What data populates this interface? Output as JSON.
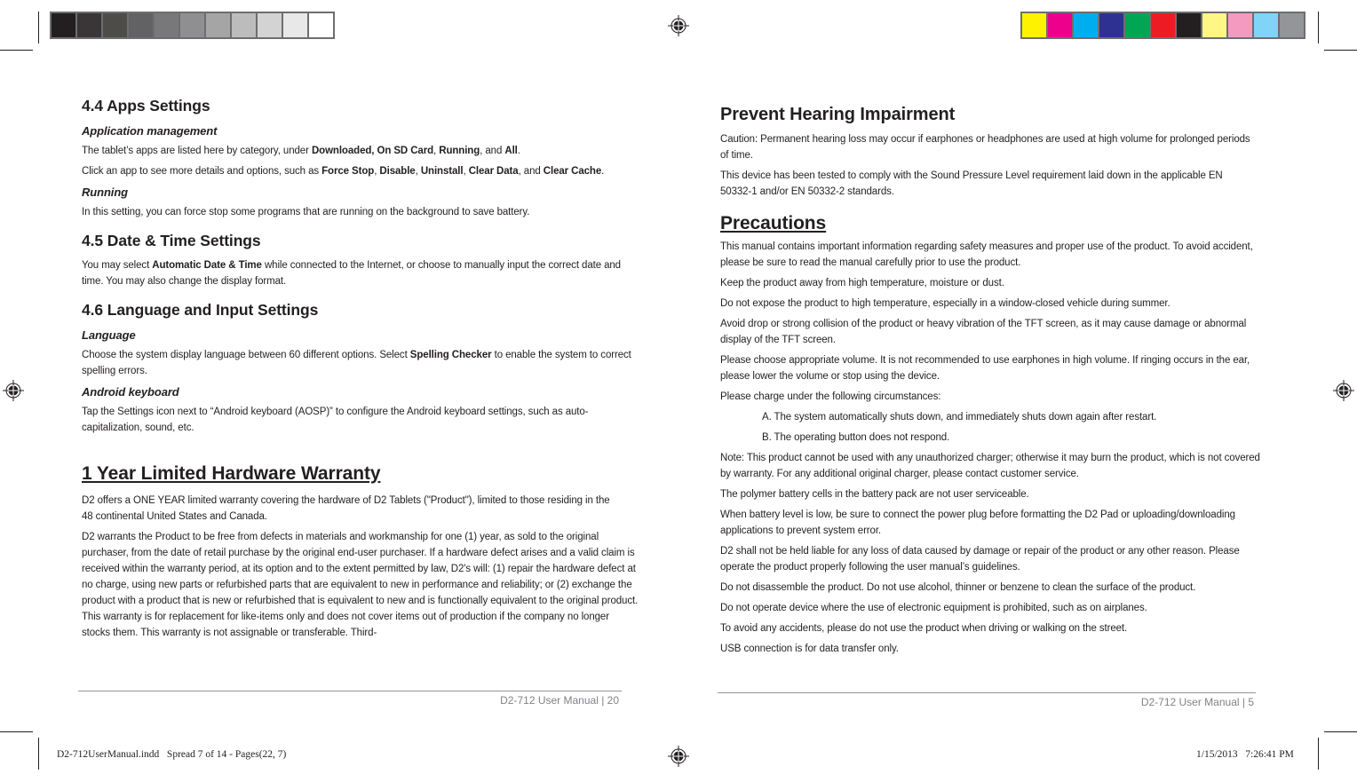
{
  "print_marks": {
    "grayscale_swatches": [
      "#231f20",
      "#3a3637",
      "#4d4c49",
      "#626163",
      "#78777a",
      "#8f8e90",
      "#a6a5a6",
      "#bcbcbd",
      "#d3d3d3",
      "#e8e8e8",
      "#ffffff"
    ],
    "color_swatches": [
      "#fff200",
      "#ec008c",
      "#00aeef",
      "#2e3192",
      "#00a651",
      "#ed1c24",
      "#231f20",
      "#fff685",
      "#f49ac1",
      "#7fd4f8",
      "#939598"
    ]
  },
  "left_page": {
    "section_44": {
      "title": "4.4 Apps Settings",
      "subsection_1": "Application management",
      "p1": {
        "t1": "The tablet’s apps are listed here by category, under ",
        "b1": "Downloaded, On SD Card",
        "t2": ", ",
        "b2": "Running",
        "t3": ", and ",
        "b3": "All",
        "t4": "."
      },
      "p2": {
        "t1": "Click an app to see more details and options, such as ",
        "b1": "Force Stop",
        "t2": ", ",
        "b2": "Disable",
        "t3": ", ",
        "b3": "Uninstall",
        "t4": ", ",
        "b4": "Clear Data",
        "t5": ", and ",
        "b5": "Clear Cache",
        "t6": "."
      },
      "subsection_2": "Running",
      "p3": "In this setting, you can force stop some programs that are running on the background to save battery."
    },
    "section_45": {
      "title": "4.5 Date & Time Settings",
      "p1": {
        "t1": "You may select ",
        "b1": "Automatic Date & Time",
        "t2": " while connected to the Internet, or choose to manually input the correct date and time. You may also change the display format."
      }
    },
    "section_46": {
      "title": "4.6 Language and Input Settings",
      "subsection_1": "Language",
      "p1": {
        "t1": "Choose the system display language between 60 different options. Select ",
        "b1": "Spelling Checker",
        "t2": " to enable the system to correct spelling errors."
      },
      "subsection_2": "Android keyboard",
      "p2": "Tap the Settings icon next to “Android keyboard (AOSP)” to configure the Android keyboard settings, such as auto-capitalization, sound, etc."
    },
    "warranty": {
      "title": "1 Year Limited Hardware Warranty",
      "p1": "D2 offers a ONE YEAR limited warranty covering the hardware of D2 Tablets (\"Product\"), limited to those residing in the 48 continental United States and Canada.",
      "p2": "D2 warrants the Product to be free from defects in materials and workmanship for one (1) year, as sold to the original purchaser, from the date of retail purchase by the original end-user purchaser. If a hardware defect arises and a valid claim is received within the warranty period, at its option and to the extent permitted by law, D2's will: (1) repair the hardware defect at no charge, using new parts or refurbished parts that are equivalent to new in performance and reliability; or (2) exchange the product with a product that is new or refurbished that is equivalent to new and is functionally equivalent to the original product. This warranty is for replacement for like-items only and does not cover items out of production if the company no longer stocks them. This warranty is not assignable or transferable. Third-"
    },
    "footer": "D2-712 User Manual | 20"
  },
  "right_page": {
    "hearing": {
      "title": "Prevent Hearing Impairment",
      "p1": "Caution: Permanent hearing loss may occur if earphones or headphones are used at high volume for prolonged periods of time.",
      "p2": "This device has been tested to comply with the Sound Pressure Level requirement laid down in the applicable EN 50332-1 and/or EN 50332-2 standards."
    },
    "precautions": {
      "title": "Precautions",
      "items": [
        "This manual contains important information regarding safety measures and proper use of the product. To avoid accident, please be sure to read the manual carefully prior to use the product.",
        "Keep the product away from high temperature, moisture or dust.",
        "Do not expose the product to high temperature, especially in a window-closed vehicle during summer.",
        "Avoid drop or strong collision of the product or heavy vibration of the TFT screen, as it may cause damage or abnormal display of the TFT screen.",
        "Please choose appropriate volume. It is not recommended to use earphones in high volume. If ringing occurs in the ear, please lower the volume or stop using the device.",
        "Please charge under the following circumstances:"
      ],
      "sub_items": [
        "A. The system automatically shuts down, and immediately shuts down again after restart.",
        "B. The operating button does not respond."
      ],
      "items_after": [
        "Note: This product cannot be used with any unauthorized charger; otherwise it may burn the product, which is not covered by warranty. For any additional original charger, please contact customer service.",
        "The polymer battery cells in the battery pack are not user serviceable.",
        "When battery level is low, be sure to connect the power plug before formatting the D2 Pad or uploading/downloading applications to prevent system error.",
        "D2 shall not be held liable for any loss of data caused by damage or repair of the product or any other reason. Please operate the product properly following the user manual’s guidelines.",
        "Do not disassemble the product. Do not use alcohol, thinner or benzene to clean the surface of the product.",
        "Do not operate device where the use of electronic equipment is prohibited, such as on airplanes.",
        "To avoid any accidents, please do not use the product when driving or walking on the street.",
        "USB connection is for data transfer only."
      ]
    },
    "footer": "D2-712 User Manual | 5"
  },
  "slug": {
    "left": "D2-712UserManual.indd   Spread 7 of 14 - Pages(22, 7)",
    "right": "1/15/2013   7:26:41 PM"
  }
}
